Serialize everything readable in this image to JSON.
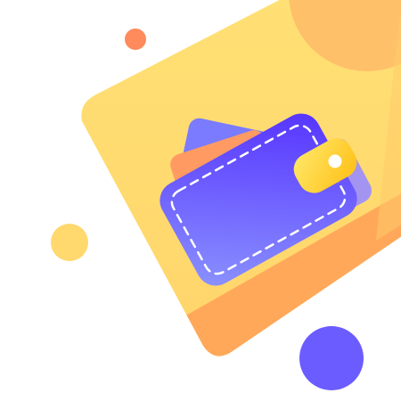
{
  "illustration": {
    "subject": "wallet-icon",
    "colors": {
      "background": "#ffffff",
      "card_top": "#ffd86e",
      "card_bottom": "#ffa85a",
      "sun": "#ffc06a",
      "wallet_left": "#7f86ff",
      "wallet_right": "#5a3cff",
      "wallet_flap": "#9a8cff",
      "inner_card_blue": "#7a7bff",
      "inner_card_orange": "#ff9a62",
      "clasp_light": "#ffe35a",
      "clasp_dark": "#ffc21a",
      "dot_orange": "#ff8a5c",
      "dot_yellow": "#ffd86e",
      "dot_purple": "#6b5cff",
      "stitch": "#ffffff"
    }
  }
}
